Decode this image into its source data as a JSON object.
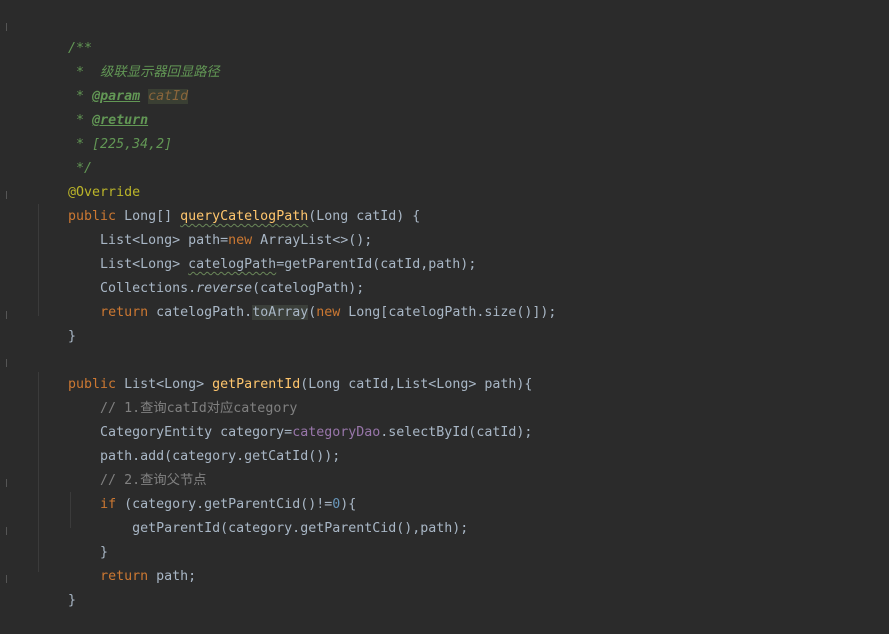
{
  "editor": {
    "lines": [
      [
        "/**"
      ],
      [
        " *  级联显示器回显路径"
      ],
      [
        " * ",
        "@param",
        " ",
        "catId"
      ],
      [
        " * ",
        "@return"
      ],
      [
        " * [225,34,2]"
      ],
      [
        " */"
      ],
      [
        "@Override"
      ],
      [
        "public",
        " Long[] ",
        "queryCatelogPath",
        "(Long catId) {"
      ],
      [
        "    List<Long> path=",
        "new",
        " ArrayList<>();"
      ],
      [
        "    List<Long> ",
        "catelogPath",
        "=getParentId(catId,path);"
      ],
      [
        "    Collections.",
        "reverse",
        "(catelogPath);"
      ],
      [
        "    ",
        "return",
        " catelogPath.",
        "toArray",
        "(",
        "new",
        " Long[catelogPath.size()]);"
      ],
      [
        "}"
      ],
      [
        ""
      ],
      [
        "public",
        " List<Long> ",
        "getParentId",
        "(Long catId,List<Long> path){"
      ],
      [
        "    // 1.查询catId对应category"
      ],
      [
        "    CategoryEntity category=",
        "categoryDao",
        ".selectById(catId);"
      ],
      [
        "    path.add(category.getCatId());"
      ],
      [
        "    // 2.查询父节点"
      ],
      [
        "    ",
        "if",
        " (category.getParentCid()!=",
        "0",
        "){"
      ],
      [
        "        getParentId(category.getParentCid(),path);"
      ],
      [
        "    }"
      ],
      [
        "    ",
        "return",
        " path;"
      ],
      [
        "}"
      ]
    ]
  }
}
